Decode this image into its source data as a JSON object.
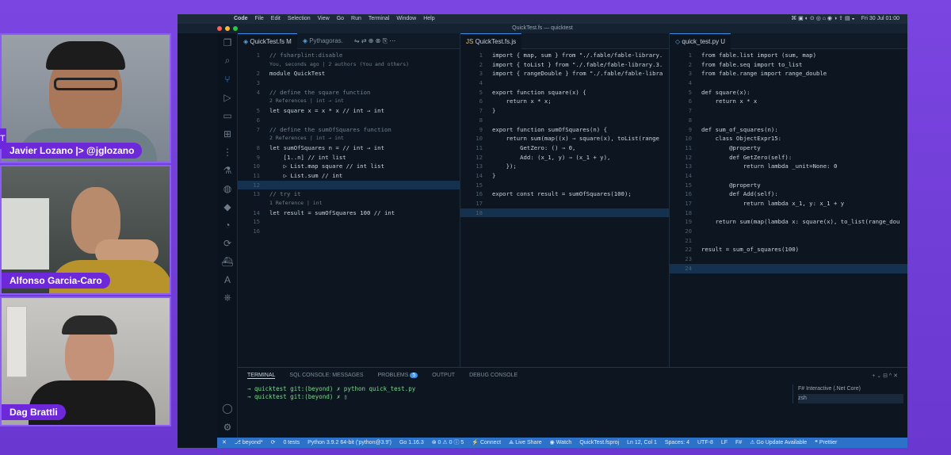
{
  "participants": [
    {
      "name": "Javier Lozano |> @jglozano"
    },
    {
      "name": "Alfonso Garcia-Caro"
    },
    {
      "name": "Dag Brattli"
    }
  ],
  "side_badge": "T",
  "menubar": {
    "apple": "",
    "items": [
      "Code",
      "File",
      "Edit",
      "Selection",
      "View",
      "Go",
      "Run",
      "Terminal",
      "Window",
      "Help"
    ],
    "clock": "Fri 30 Jul 01:00"
  },
  "window_title": "QuickTest.fs — quicktest",
  "pane1": {
    "tabs": [
      {
        "label": "QuickTest.fs M"
      },
      {
        "label": "Pythagoras."
      }
    ],
    "blame": "You, seconds ago | 2 authors (You and others)",
    "lines": [
      {
        "n": "1",
        "t": "// fsharplint:disable",
        "c": "cm"
      },
      {
        "lens": "You, seconds ago | 2 authors (You and others)"
      },
      {
        "n": "2",
        "t": "module QuickTest",
        "c": ""
      },
      {
        "n": "3",
        "t": "",
        "c": ""
      },
      {
        "n": "4",
        "t": "// define the square function",
        "c": "cm"
      },
      {
        "lens": "2 References | int → int"
      },
      {
        "n": "5",
        "t": "let square x = x * x // int → int",
        "c": ""
      },
      {
        "n": "6",
        "t": "",
        "c": ""
      },
      {
        "n": "7",
        "t": "// define the sumOfSquares function",
        "c": "cm"
      },
      {
        "lens": "2 References | int → int"
      },
      {
        "n": "8",
        "t": "let sumOfSquares n = // int → int",
        "c": ""
      },
      {
        "n": "9",
        "t": "    [1..n] // int list",
        "c": ""
      },
      {
        "n": "10",
        "t": "    ▷ List.map square // int list",
        "c": ""
      },
      {
        "n": "11",
        "t": "    ▷ List.sum // int",
        "c": ""
      },
      {
        "n": "12",
        "t": "",
        "c": "",
        "cur": true
      },
      {
        "n": "13",
        "t": "// try it",
        "c": "cm"
      },
      {
        "lens": "1 Reference | int"
      },
      {
        "n": "14",
        "t": "let result = sumOfSquares 100 // int",
        "c": ""
      },
      {
        "n": "15",
        "t": "",
        "c": ""
      },
      {
        "n": "16",
        "t": "",
        "c": ""
      }
    ]
  },
  "pane2": {
    "tabs": [
      {
        "label": "QuickTest.fs.js"
      }
    ],
    "lines": [
      {
        "n": "1",
        "t": "import { map, sum } from \"./.fable/fable-library.",
        "c": ""
      },
      {
        "n": "2",
        "t": "import { toList } from \"./.fable/fable-library.3.",
        "c": ""
      },
      {
        "n": "3",
        "t": "import { rangeDouble } from \"./.fable/fable-libra",
        "c": ""
      },
      {
        "n": "4",
        "t": "",
        "c": ""
      },
      {
        "n": "5",
        "t": "export function square(x) {",
        "c": ""
      },
      {
        "n": "6",
        "t": "    return x * x;",
        "c": ""
      },
      {
        "n": "7",
        "t": "}",
        "c": ""
      },
      {
        "n": "8",
        "t": "",
        "c": ""
      },
      {
        "n": "9",
        "t": "export function sumOfSquares(n) {",
        "c": ""
      },
      {
        "n": "10",
        "t": "    return sum(map((x) ⇒ square(x), toList(range",
        "c": ""
      },
      {
        "n": "11",
        "t": "        GetZero: () ⇒ 0,",
        "c": ""
      },
      {
        "n": "12",
        "t": "        Add: (x_1, y) ⇒ (x_1 + y),",
        "c": ""
      },
      {
        "n": "13",
        "t": "    });",
        "c": ""
      },
      {
        "n": "14",
        "t": "}",
        "c": ""
      },
      {
        "n": "15",
        "t": "",
        "c": ""
      },
      {
        "n": "16",
        "t": "export const result = sumOfSquares(100);",
        "c": ""
      },
      {
        "n": "17",
        "t": "",
        "c": ""
      },
      {
        "n": "18",
        "t": "",
        "c": "",
        "cur": true
      }
    ]
  },
  "pane3": {
    "tabs": [
      {
        "label": "quick_test.py U"
      }
    ],
    "lines": [
      {
        "n": "1",
        "t": "from fable.list import (sum, map)",
        "c": ""
      },
      {
        "n": "2",
        "t": "from fable.seq import to_list",
        "c": ""
      },
      {
        "n": "3",
        "t": "from fable.range import range_double",
        "c": ""
      },
      {
        "n": "4",
        "t": "",
        "c": ""
      },
      {
        "n": "5",
        "t": "def square(x):",
        "c": ""
      },
      {
        "n": "6",
        "t": "    return x * x",
        "c": ""
      },
      {
        "n": "7",
        "t": "",
        "c": ""
      },
      {
        "n": "8",
        "t": "",
        "c": ""
      },
      {
        "n": "9",
        "t": "def sum_of_squares(n):",
        "c": ""
      },
      {
        "n": "10",
        "t": "    class ObjectExpr15:",
        "c": ""
      },
      {
        "n": "11",
        "t": "        @property",
        "c": ""
      },
      {
        "n": "12",
        "t": "        def GetZero(self):",
        "c": ""
      },
      {
        "n": "13",
        "t": "            return lambda _unit=None: 0",
        "c": ""
      },
      {
        "n": "14",
        "t": "",
        "c": ""
      },
      {
        "n": "15",
        "t": "        @property",
        "c": ""
      },
      {
        "n": "16",
        "t": "        def Add(self):",
        "c": ""
      },
      {
        "n": "17",
        "t": "            return lambda x_1, y: x_1 + y",
        "c": ""
      },
      {
        "n": "18",
        "t": "",
        "c": ""
      },
      {
        "n": "19",
        "t": "    return sum(map(lambda x: square(x), to_list(range_dou",
        "c": ""
      },
      {
        "n": "20",
        "t": "",
        "c": ""
      },
      {
        "n": "21",
        "t": "",
        "c": ""
      },
      {
        "n": "22",
        "t": "result = sum_of_squares(100)",
        "c": ""
      },
      {
        "n": "23",
        "t": "",
        "c": ""
      },
      {
        "n": "24",
        "t": "",
        "c": "",
        "cur": true
      }
    ]
  },
  "panel": {
    "tabs": [
      "TERMINAL",
      "SQL CONSOLE: MESSAGES",
      "PROBLEMS",
      "OUTPUT",
      "DEBUG CONSOLE"
    ],
    "problems_count": "5",
    "term": [
      "→  quicktest git:(beyond) ✗ python quick_test.py",
      "→  quicktest git:(beyond) ✗ ▯"
    ],
    "side_items": [
      "F# Interactive (.Net Core)",
      "zsh"
    ]
  },
  "status": [
    "✕",
    "⎇ beyond*",
    "⟳",
    "0 tests",
    "Python 3.9.2 64-bit ('python@3.9')",
    "Go 1.16.3",
    "⊗ 0 ⚠ 0 ⓘ 5",
    "⚡ Connect",
    "⟁ Live Share",
    "◉ Watch",
    "QuickTest.fsproj",
    "Ln 12, Col 1",
    "Spaces: 4",
    "UTF-8",
    "LF",
    "F#",
    "⚠ Go Update Available",
    "❝ Prettier"
  ]
}
